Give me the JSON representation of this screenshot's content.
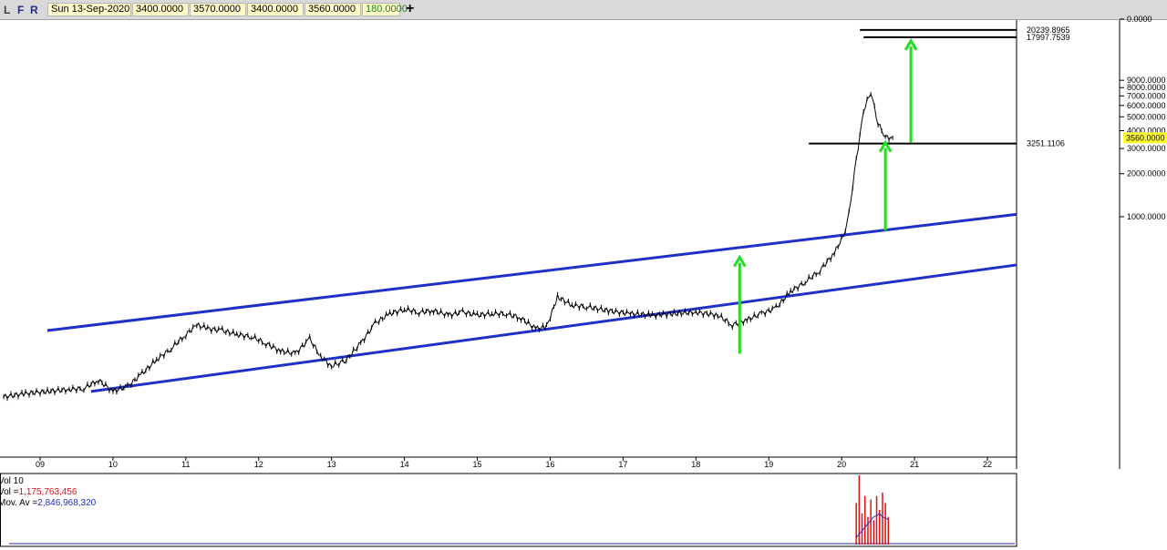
{
  "toolbar": {
    "buttons": [
      "L",
      "F",
      "R"
    ],
    "date": "Sun 13-Sep-2020",
    "open": "3400.0000",
    "high": "3570.0000",
    "low": "3400.0000",
    "close": "3560.0000",
    "change": "180.0000",
    "add_symbol": "+"
  },
  "colors": {
    "channel": "#1f2fc8",
    "arrow": "#22dd22",
    "price": "#000000",
    "volume_bar": "#e01010",
    "volume_avg": "#1f2fc8",
    "last_price_highlight": "#ffff33"
  },
  "chart_data": [
    {
      "type": "line",
      "scale": "log",
      "x_ticks": [
        "09",
        "10",
        "11",
        "12",
        "13",
        "14",
        "15",
        "16",
        "17",
        "18",
        "19",
        "20",
        "21",
        "22"
      ],
      "y_ticks": [
        "0.0000",
        "9000.0000",
        "8000.0000",
        "7000.0000",
        "6000.0000",
        "5000.0000",
        "4000.0000",
        "3000.0000",
        "2000.0000",
        "1000.0000"
      ],
      "last_price": "3560.0000",
      "levels": [
        {
          "label": "20239.8965",
          "value": 20239.8965
        },
        {
          "label": "17997.7539",
          "value": 17997.7539
        },
        {
          "label": "3251.1106",
          "value": 3251.1106
        }
      ],
      "channel_upper": {
        "from": [
          9.1,
          160
        ],
        "to": [
          22.4,
          1040
        ]
      },
      "channel_lower": {
        "from": [
          9.7,
          60
        ],
        "to": [
          22.4,
          460
        ]
      },
      "arrows": [
        {
          "x": 18.6,
          "from": 110,
          "to": 520
        },
        {
          "x": 20.6,
          "from": 800,
          "to": 3300
        },
        {
          "x": 20.95,
          "from": 3300,
          "to": 17000
        }
      ],
      "series": [
        {
          "x": [
            8.5,
            8.8,
            9.1,
            9.4,
            9.6,
            9.8,
            10.0,
            10.2,
            10.4,
            10.6,
            10.8,
            11.0,
            11.15,
            11.3,
            11.5,
            11.7,
            11.9,
            12.1,
            12.3,
            12.5,
            12.7,
            12.85,
            13.0,
            13.1,
            13.2,
            13.4,
            13.6,
            13.8,
            14.0,
            14.2,
            14.4,
            14.6,
            14.8,
            15.0,
            15.2,
            15.4,
            15.6,
            15.8,
            15.95,
            16.1,
            16.3,
            16.5,
            16.8,
            17.1,
            17.4,
            17.7,
            18.0,
            18.3,
            18.5,
            18.7,
            18.9,
            19.1,
            19.3,
            19.5,
            19.7,
            19.9,
            20.05,
            20.1,
            20.2,
            20.3,
            20.4,
            20.5,
            20.6,
            20.7
          ],
          "y": [
            55,
            58,
            60,
            62,
            63,
            72,
            60,
            65,
            80,
            100,
            120,
            150,
            175,
            165,
            160,
            150,
            145,
            130,
            115,
            110,
            140,
            105,
            90,
            95,
            100,
            130,
            180,
            210,
            225,
            215,
            220,
            205,
            215,
            205,
            210,
            210,
            195,
            165,
            170,
            275,
            240,
            235,
            220,
            210,
            205,
            210,
            215,
            205,
            175,
            190,
            210,
            230,
            300,
            350,
            420,
            560,
            780,
            1050,
            2500,
            5500,
            7500,
            4500,
            3600,
            3560
          ]
        }
      ]
    },
    {
      "type": "bar",
      "title": "Vol 10",
      "vol_label": "Vol =",
      "vol_value": "1,175,763,456",
      "mov_label": "Mov. Av =",
      "mov_value": "2,846,968,320",
      "x": [
        20.2,
        20.24,
        20.28,
        20.32,
        20.36,
        20.4,
        20.44,
        20.48,
        20.52,
        20.56,
        20.6,
        20.64
      ],
      "values": [
        0.6,
        1.0,
        0.45,
        0.7,
        0.4,
        0.65,
        0.35,
        0.7,
        0.5,
        0.75,
        0.6,
        0.4
      ],
      "moving_average": [
        0.1,
        0.15,
        0.2,
        0.25,
        0.3,
        0.35,
        0.4,
        0.42,
        0.45,
        0.4,
        0.38,
        0.36
      ]
    }
  ]
}
